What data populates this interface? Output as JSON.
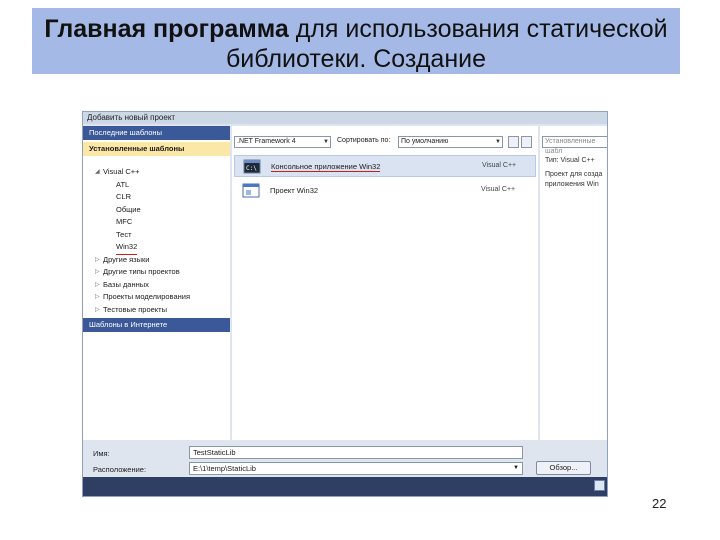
{
  "slide": {
    "title_bold": "Главная программа",
    "title_rest": " для использования статической библиотеки. Создание",
    "page_number": "22"
  },
  "dialog": {
    "title": "Добавить новый проект",
    "left": {
      "recent": "Последние шаблоны",
      "installed": "Установленные шаблоны",
      "tree": [
        {
          "label": "Visual C++",
          "expanded": true
        },
        {
          "label": "ATL",
          "child": true
        },
        {
          "label": "CLR",
          "child": true
        },
        {
          "label": "Общие",
          "child": true
        },
        {
          "label": "MFC",
          "child": true
        },
        {
          "label": "Тест",
          "child": true
        },
        {
          "label": "Win32",
          "child": true,
          "underlined": true
        },
        {
          "label": "Другие языки"
        },
        {
          "label": "Другие типы проектов"
        },
        {
          "label": "Базы данных"
        },
        {
          "label": "Проекты моделирования"
        },
        {
          "label": "Тестовые проекты"
        }
      ],
      "online": "Шаблоны в Интернете"
    },
    "toolbar": {
      "framework": ".NET Framework 4",
      "sort_label": "Сортировать по:",
      "sort_value": "По умолчанию"
    },
    "templates": [
      {
        "name": "Консольное приложение Win32",
        "lang": "Visual C++",
        "selected": true
      },
      {
        "name": "Проект Win32",
        "lang": "Visual C++",
        "selected": false
      }
    ],
    "right": {
      "search_placeholder": "Установленные шабл",
      "type": "Тип: Visual C++",
      "desc1": "Проект для созда",
      "desc2": "приложения Win"
    },
    "form": {
      "name_label": "Имя:",
      "name_value": "TestStaticLib",
      "location_label": "Расположение:",
      "location_value": "E:\\1\\temp\\StaticLib",
      "browse": "Обзор..."
    }
  },
  "colors": {
    "title_band": "#a4b9e6",
    "accent": "#3b5998",
    "underline": "#cc1c1c"
  }
}
